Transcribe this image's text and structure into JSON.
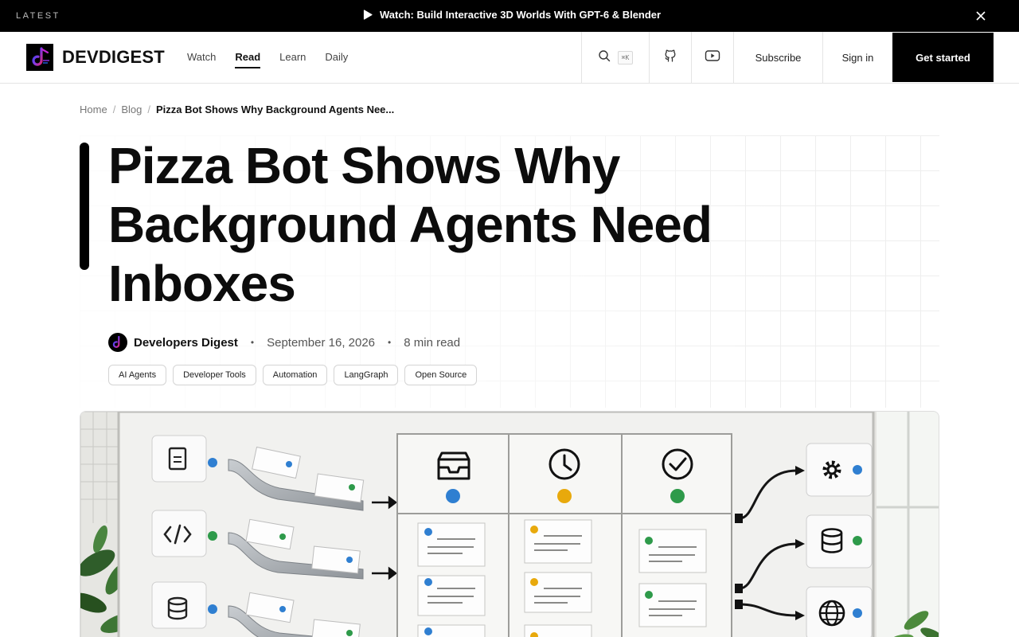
{
  "announcement": {
    "label": "LATEST",
    "text": "Watch: Build Interactive 3D Worlds With GPT-6 & Blender"
  },
  "header": {
    "logo_text": "DEVDIGEST",
    "nav": [
      {
        "label": "Watch",
        "active": false
      },
      {
        "label": "Read",
        "active": true
      },
      {
        "label": "Learn",
        "active": false
      },
      {
        "label": "Daily",
        "active": false
      }
    ],
    "search_shortcut": "⌘K",
    "subscribe": "Subscribe",
    "sign_in": "Sign in",
    "get_started": "Get started"
  },
  "breadcrumb": {
    "home": "Home",
    "blog": "Blog",
    "current": "Pizza Bot Shows Why Background Agents Nee..."
  },
  "article": {
    "title": "Pizza Bot Shows Why Background Agents Need Inboxes",
    "author": "Developers Digest",
    "date": "September 16, 2026",
    "read_time": "8 min read",
    "tags": [
      "AI Agents",
      "Developer Tools",
      "Automation",
      "LangGraph",
      "Open Source"
    ]
  },
  "colors": {
    "accent_blue": "#2f7fd1",
    "accent_green": "#2e9a4a",
    "accent_yellow": "#e8a90c"
  },
  "icons": {
    "play": "play-icon",
    "close": "close-icon",
    "search": "search-icon",
    "github": "github-icon",
    "youtube": "youtube-icon"
  }
}
